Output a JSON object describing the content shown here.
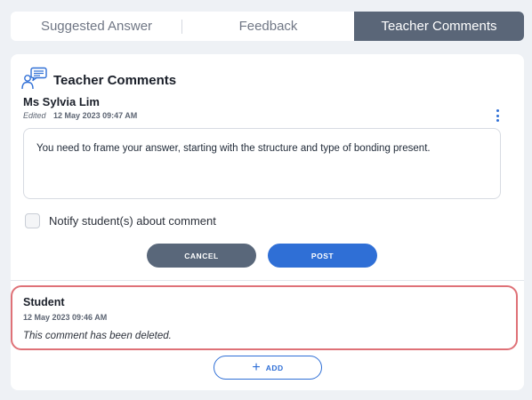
{
  "tabs": [
    {
      "label": "Suggested Answer",
      "active": false
    },
    {
      "label": "Feedback",
      "active": false
    },
    {
      "label": "Teacher Comments",
      "active": true
    }
  ],
  "section": {
    "icon": "teacher-chat-icon",
    "title": "Teacher Comments"
  },
  "comment": {
    "author": "Ms Sylvia Lim",
    "edited_label": "Edited",
    "timestamp": "12 May 2023 09:47 AM",
    "text": "You need to frame your answer, starting with the structure and type of bonding present.",
    "menu_icon": "kebab-menu-icon"
  },
  "notify": {
    "label": "Notify student(s) about comment",
    "checked": false
  },
  "actions": {
    "cancel_label": "CANCEL",
    "post_label": "POST"
  },
  "student_comment": {
    "author": "Student",
    "timestamp": "12 May 2023 09:46 AM",
    "text": "This comment has been deleted."
  },
  "add": {
    "icon": "plus-icon",
    "label": "ADD"
  },
  "colors": {
    "primary": "#2f6fd6",
    "active_tab": "#5a6678",
    "cancel": "#59677a",
    "highlight_border": "#df7177"
  }
}
